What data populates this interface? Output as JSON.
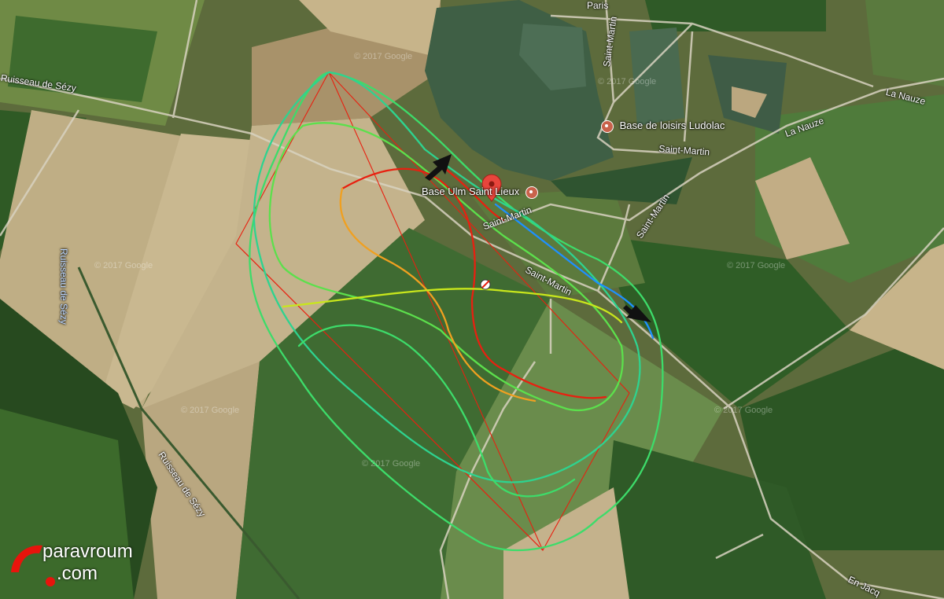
{
  "map": {
    "labels": {
      "ruisseau_top": "Ruisseau de Sézy",
      "ruisseau_left": "Ruisseau de Sézy",
      "ruisseau_bottom": "Ruisseau de Sézy",
      "saint_martin_1": "Saint-Martin",
      "saint_martin_2": "Saint-Martin",
      "saint_martin_3": "Saint-Martin",
      "saint_martin_4": "Saint-Martin",
      "saint_martin_5": "Saint-Martin",
      "la_nauze_1": "La Nauze",
      "la_nauze_2": "La Nauze",
      "paris": "Paris",
      "en_jacq": "En Jacq",
      "base_ulm": "Base Ulm Saint Lieux",
      "base_loisirs": "Base de loisirs Ludolac"
    },
    "watermark": "© 2017 Google",
    "colors": {
      "track_green": "#3ddc6a",
      "track_yellow": "#c8e61c",
      "track_orange": "#f0a020",
      "track_red": "#e82010",
      "track_blue": "#1e90ff",
      "marker_red": "#e8453c"
    }
  },
  "logo": {
    "line1": "paravroum",
    "line2": ".com"
  }
}
